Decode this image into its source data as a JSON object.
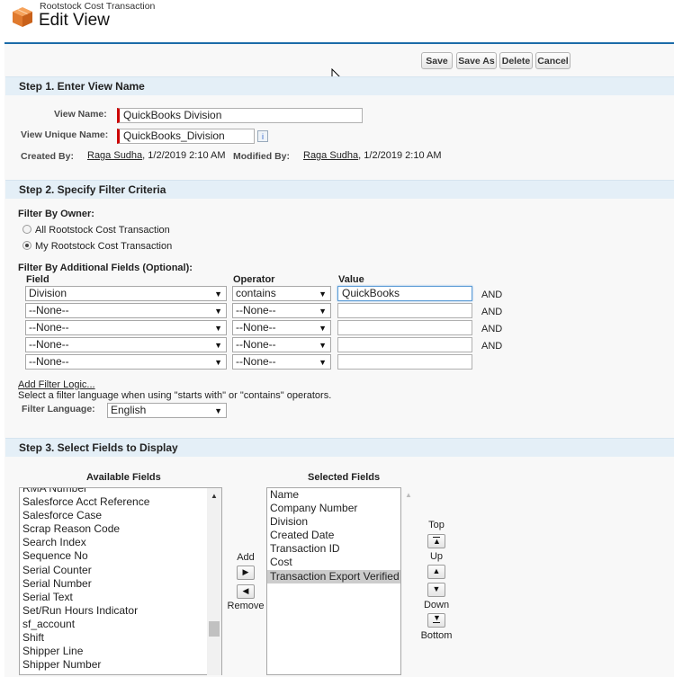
{
  "header": {
    "object_label": "Rootstock Cost Transaction",
    "title": "Edit View",
    "icon": "cube-icon",
    "accent": "#1b6ba8"
  },
  "toolbar": {
    "save": "Save",
    "save_as": "Save As",
    "delete": "Delete",
    "cancel": "Cancel"
  },
  "step1": {
    "title": "Step 1. Enter View Name",
    "view_name_label": "View Name:",
    "view_name_value": "QuickBooks Division",
    "unique_name_label": "View Unique Name:",
    "unique_name_value": "QuickBooks_Division",
    "created_by_label": "Created By:",
    "created_by_user": "Raga Sudha",
    "created_by_date": ", 1/2/2019 2:10 AM",
    "modified_by_label": "Modified By:",
    "modified_by_user": "Raga Sudha",
    "modified_by_date": ", 1/2/2019 2:10 AM"
  },
  "step2": {
    "title": "Step 2. Specify Filter Criteria",
    "owner_label": "Filter By Owner:",
    "owner_all": "All Rootstock Cost Transaction",
    "owner_my": "My Rootstock Cost Transaction",
    "additional_label": "Filter By Additional Fields (Optional):",
    "col_field": "Field",
    "col_operator": "Operator",
    "col_value": "Value",
    "rows": [
      {
        "field": "Division",
        "operator": "contains",
        "value": "QuickBooks",
        "and": "AND"
      },
      {
        "field": "--None--",
        "operator": "--None--",
        "value": "",
        "and": "AND"
      },
      {
        "field": "--None--",
        "operator": "--None--",
        "value": "",
        "and": "AND"
      },
      {
        "field": "--None--",
        "operator": "--None--",
        "value": "",
        "and": "AND"
      },
      {
        "field": "--None--",
        "operator": "--None--",
        "value": "",
        "and": ""
      }
    ],
    "add_logic": "Add Filter Logic...",
    "language_hint": "Select a filter language when using \"starts with\" or \"contains\" operators.",
    "language_label": "Filter Language:",
    "language_value": "English"
  },
  "step3": {
    "title": "Step 3. Select Fields to Display",
    "available_label": "Available Fields",
    "selected_label": "Selected Fields",
    "available": [
      "RMA Number",
      "Salesforce Acct Reference",
      "Salesforce Case",
      "Scrap Reason Code",
      "Search Index",
      "Sequence No",
      "Serial Counter",
      "Serial Number",
      "Serial Text",
      "Set/Run Hours Indicator",
      "sf_account",
      "Shift",
      "Shipper Line",
      "Shipper Number"
    ],
    "selected": [
      "Name",
      "Company Number",
      "Division",
      "Created Date",
      "Transaction ID",
      "Cost",
      "Transaction Export Verified"
    ],
    "add": "Add",
    "remove": "Remove",
    "top": "Top",
    "up": "Up",
    "down": "Down",
    "bottom": "Bottom"
  }
}
